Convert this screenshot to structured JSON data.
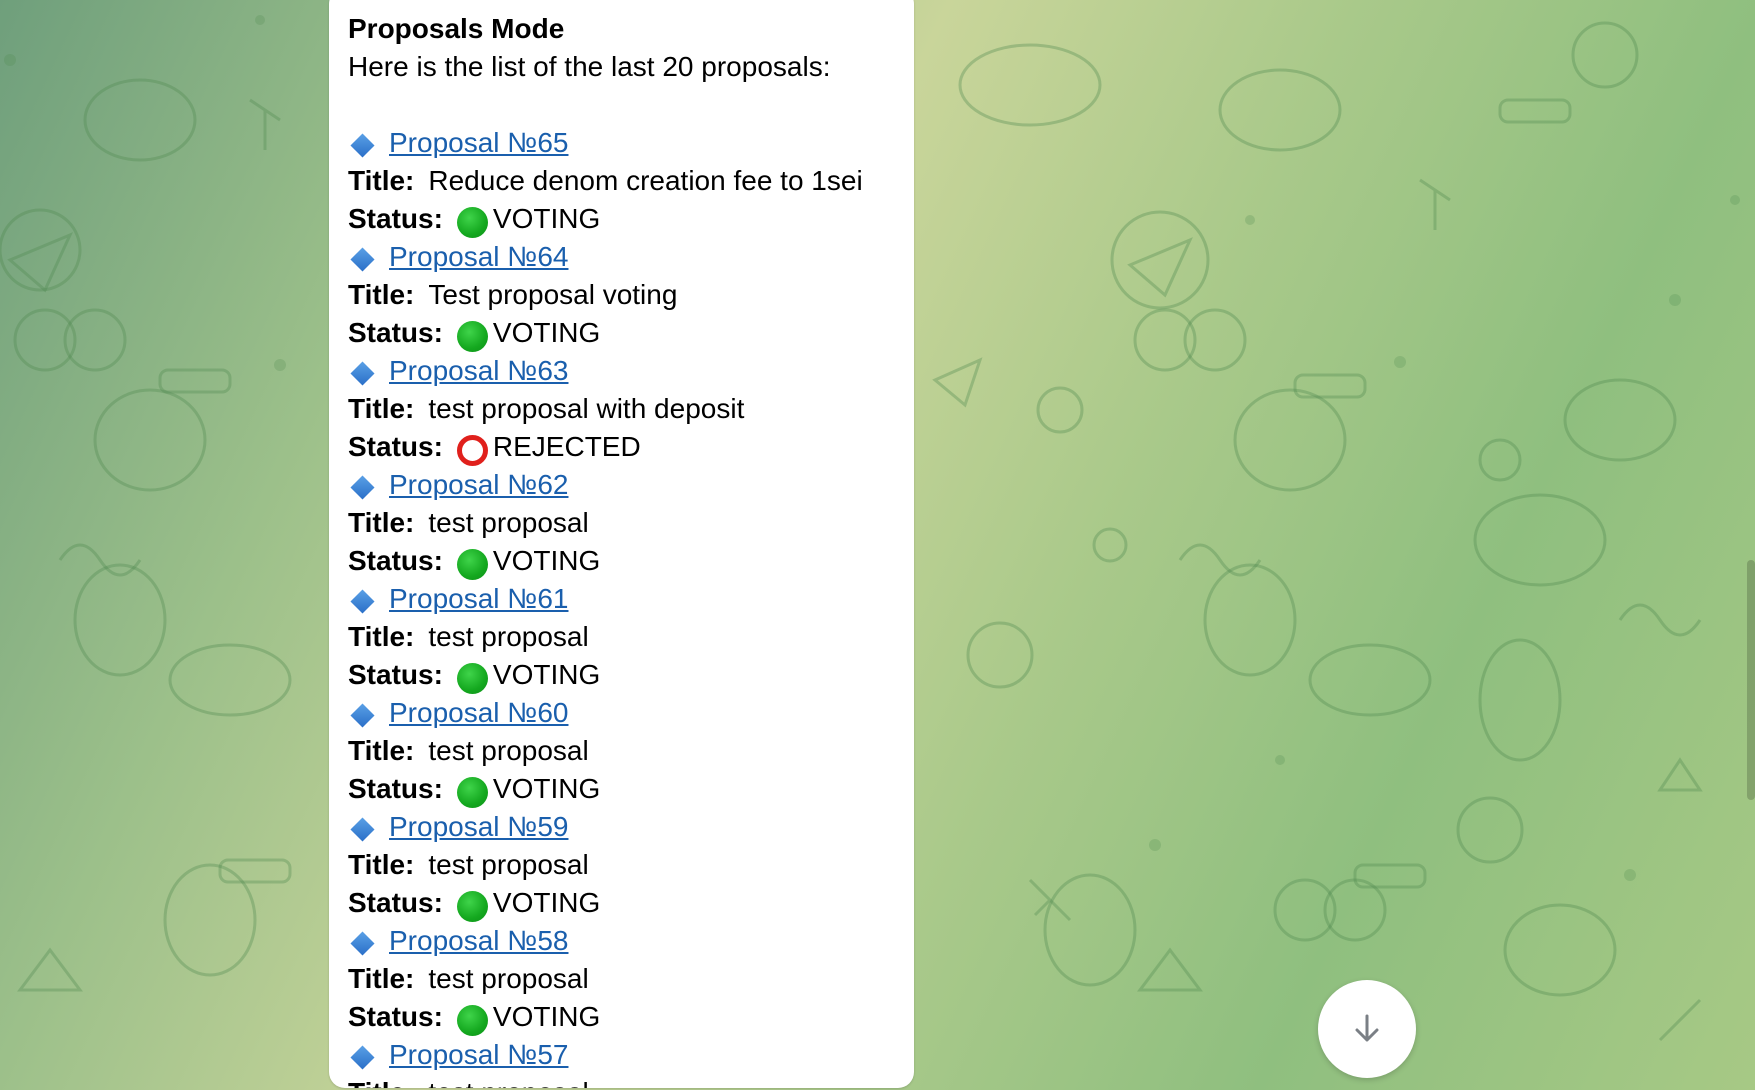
{
  "chat": {
    "background_colors": [
      "#6f9f7c",
      "#c9d59a",
      "#8fbf7f"
    ],
    "message": {
      "header": "Proposals Mode",
      "intro": "Here is the list of the last 20 proposals:",
      "title_label": "Title:",
      "status_label": "Status:",
      "proposals": [
        {
          "link": "Proposal №65",
          "title": "Reduce denom creation fee to 1sei",
          "status": "VOTING",
          "status_icon": "green-circle"
        },
        {
          "link": "Proposal №64",
          "title": "Test proposal voting",
          "status": "VOTING",
          "status_icon": "green-circle"
        },
        {
          "link": "Proposal №63",
          "title": "test proposal with deposit",
          "status": "REJECTED",
          "status_icon": "red-hollow-circle"
        },
        {
          "link": "Proposal №62",
          "title": "test proposal",
          "status": "VOTING",
          "status_icon": "green-circle"
        },
        {
          "link": "Proposal №61",
          "title": "test proposal",
          "status": "VOTING",
          "status_icon": "green-circle"
        },
        {
          "link": "Proposal №60",
          "title": "test proposal",
          "status": "VOTING",
          "status_icon": "green-circle"
        },
        {
          "link": "Proposal №59",
          "title": "test proposal",
          "status": "VOTING",
          "status_icon": "green-circle"
        },
        {
          "link": "Proposal №58",
          "title": "test proposal",
          "status": "VOTING",
          "status_icon": "green-circle"
        },
        {
          "link": "Proposal №57",
          "title": "test proposal",
          "status": "",
          "status_icon": ""
        }
      ]
    },
    "scroll_down_icon": "arrow-down-icon"
  }
}
